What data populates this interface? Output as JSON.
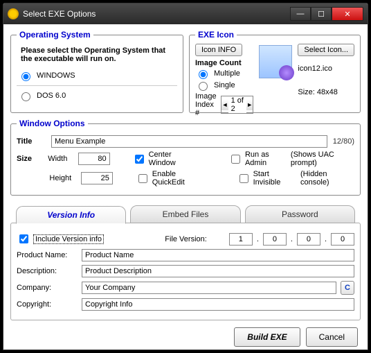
{
  "titlebar": {
    "title": "Select EXE Options"
  },
  "os": {
    "legend": "Operating System",
    "instruction": "Please select the Operating System that the executable will run on.",
    "options": [
      "WINDOWS",
      "DOS 6.0"
    ],
    "selected": "WINDOWS"
  },
  "exeicon": {
    "legend": "EXE Icon",
    "info_btn": "Icon INFO",
    "select_btn": "Select Icon...",
    "image_count_label": "Image Count",
    "multiple": "Multiple",
    "single": "Single",
    "count_selected": "Multiple",
    "index_label": "Image Index #",
    "index_value": "1 of 2",
    "filename": "icon12.ico",
    "size_label": "Size: 48x48"
  },
  "winopt": {
    "legend": "Window Options",
    "title_label": "Title",
    "title_value": "Menu Example",
    "title_counter": "12/80)",
    "size_label": "Size",
    "width_label": "Width",
    "width_value": "80",
    "height_label": "Height",
    "height_value": "25",
    "center": "Center Window",
    "center_checked": true,
    "quickedit": "Enable QuickEdit",
    "quickedit_checked": false,
    "runadmin": "Run as Admin",
    "runadmin_hint": "(Shows UAC prompt)",
    "runadmin_checked": false,
    "startinv": "Start Invisible",
    "startinv_hint": "(Hidden console)",
    "startinv_checked": false
  },
  "tabs": {
    "version": "Version Info",
    "embed": "Embed Files",
    "password": "Password",
    "active": "version"
  },
  "version": {
    "include_label": "Include Version info",
    "include_checked": true,
    "fileversion_label": "File Version:",
    "fv": [
      "1",
      "0",
      "0",
      "0"
    ],
    "product_name_label": "Product Name:",
    "product_name": "Product Name",
    "description_label": "Description:",
    "description": "Product Description",
    "company_label": "Company:",
    "company": "Your Company",
    "copyright_label": "Copyright:",
    "copyright": "Copyright Info"
  },
  "actions": {
    "build": "Build EXE",
    "cancel": "Cancel"
  }
}
